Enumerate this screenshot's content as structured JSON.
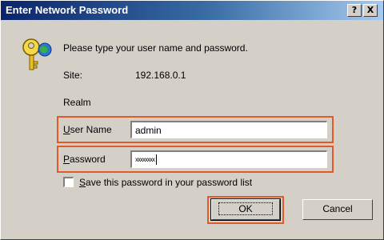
{
  "window": {
    "title": "Enter Network Password",
    "help_glyph": "?",
    "close_glyph": "X"
  },
  "dialog": {
    "prompt": "Please type your user name and password.",
    "site_label": "Site:",
    "site_value": "192.168.0.1",
    "realm_label": "Realm",
    "user_label_ul": "U",
    "user_label_rest": "ser Name",
    "user_value": "admin",
    "password_label_ul": "P",
    "password_label_rest": "assword",
    "password_value": "xxxxxxxx",
    "save_label_ul": "S",
    "save_label_rest": "ave this password in your password list",
    "save_checked": false,
    "ok_label": "OK",
    "cancel_label": "Cancel",
    "key_icon": "key-icon"
  },
  "colors": {
    "highlight_outline": "#e05a2a",
    "titlebar_start": "#0a246a",
    "titlebar_end": "#a6caf0",
    "face": "#d4d0c8"
  }
}
